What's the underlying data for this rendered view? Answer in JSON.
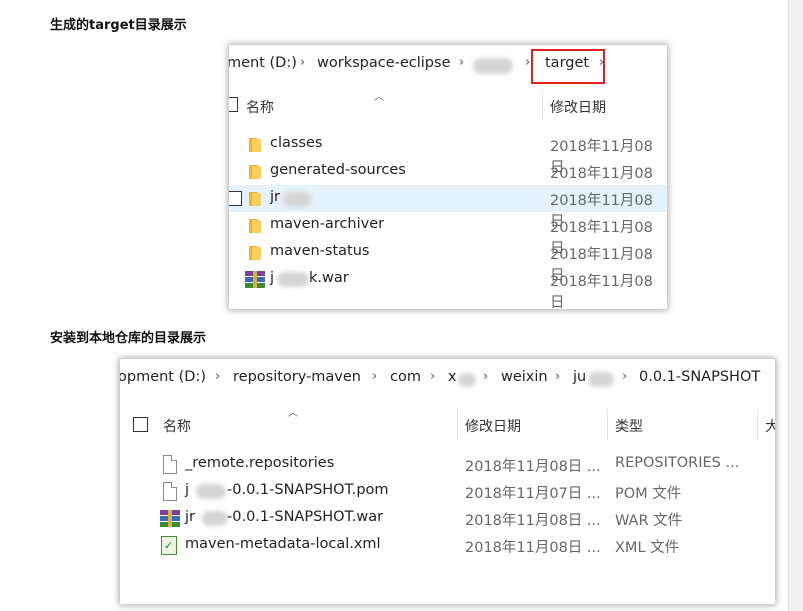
{
  "page": {
    "heading1": "生成的target目录展示",
    "heading2": "安装到本地仓库的目录展示"
  },
  "win1": {
    "breadcrumbs": [
      "ment (D:)",
      "workspace-eclipse",
      "target"
    ],
    "col_name": "名称",
    "col_date": "修改日期",
    "files": [
      {
        "name": "classes",
        "date": "2018年11月08日",
        "icon": "folder-icon"
      },
      {
        "name": "generated-sources",
        "date": "2018年11月08日",
        "icon": "folder-icon"
      },
      {
        "name": "jr",
        "date": "2018年11月08日",
        "icon": "folder-icon"
      },
      {
        "name": "maven-archiver",
        "date": "2018年11月08日",
        "icon": "folder-icon"
      },
      {
        "name": "maven-status",
        "date": "2018年11月08日",
        "icon": "folder-icon"
      },
      {
        "name": "j",
        "name_suffix": "k.war",
        "date": "2018年11月08日",
        "icon": "winrar-archive-icon"
      }
    ]
  },
  "win2": {
    "breadcrumbs": [
      "opment (D:)",
      "repository-maven",
      "com",
      "x",
      "weixin",
      "ju",
      "0.0.1-SNAPSHOT"
    ],
    "col_name": "名称",
    "col_date": "修改日期",
    "col_type": "类型",
    "col_size": "大",
    "files": [
      {
        "name": "_remote.repositories",
        "date": "2018年11月08日 ...",
        "type": "REPOSITORIES ...",
        "icon": "file-icon"
      },
      {
        "name": "j",
        "name_suffix": "-0.0.1-SNAPSHOT.pom",
        "date": "2018年11月07日 ...",
        "type": "POM 文件",
        "icon": "file-icon"
      },
      {
        "name": "jr",
        "name_suffix": "-0.0.1-SNAPSHOT.war",
        "date": "2018年11月08日 ...",
        "type": "WAR 文件",
        "icon": "winrar-archive-icon"
      },
      {
        "name": "maven-metadata-local.xml",
        "date": "2018年11月08日 ...",
        "type": "XML 文件",
        "icon": "xml-file-icon"
      }
    ]
  },
  "colors": {
    "highlight_box": "#e0201e",
    "selected_row": "#e5f1fb"
  }
}
